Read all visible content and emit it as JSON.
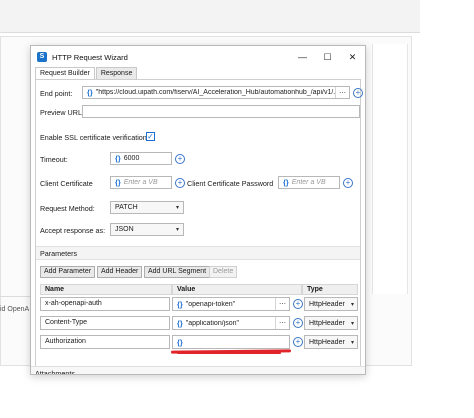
{
  "background": {
    "left_text": "id OpenA"
  },
  "dialog": {
    "title": "HTTP Request Wizard",
    "window_buttons": {
      "minimize": "—",
      "maximize": "☐",
      "close": "✕"
    },
    "tabs": [
      {
        "label": "Request Builder",
        "active": true
      },
      {
        "label": "Response",
        "active": false
      }
    ],
    "fields": {
      "end_point": {
        "label": "End point:",
        "value": "\"https://cloud.uipath.com/fiserv/AI_Acceleration_Hub/automationhub_/api/v1/..."
      },
      "preview_url": {
        "label": "Preview URL:",
        "value": ""
      },
      "ssl": {
        "label": "Enable SSL certificate verification",
        "checked": true
      },
      "timeout": {
        "label": "Timeout:",
        "value": "6000"
      },
      "client_certificate": {
        "label": "Client Certificate",
        "placeholder": "Enter a VB"
      },
      "client_certificate_password": {
        "label": "Client Certificate Password",
        "placeholder": "Enter a VB"
      },
      "request_method": {
        "label": "Request Method:",
        "value": "PATCH"
      },
      "accept_response": {
        "label": "Accept response as:",
        "value": "JSON"
      }
    },
    "parameters": {
      "header": "Parameters",
      "buttons": {
        "add_parameter": "Add Parameter",
        "add_header": "Add Header",
        "add_url_segment": "Add URL Segment",
        "delete": "Delete"
      },
      "columns": {
        "name": "Name",
        "value": "Value",
        "type": "Type"
      },
      "rows": [
        {
          "name": "x-ah-openapi-auth",
          "value": "\"openapi-token\"",
          "type": "HttpHeader"
        },
        {
          "name": "Content-Type",
          "value": "\"application/json\"",
          "type": "HttpHeader"
        },
        {
          "name": "Authorization",
          "value": "",
          "type": "HttpHeader"
        }
      ]
    },
    "attachments": {
      "header": "Attachments"
    },
    "icons": {
      "curly": "{}",
      "dots": "⋯",
      "plus": "+",
      "check": "✓",
      "caret": "▾"
    },
    "colors": {
      "accent": "#1a6fd1",
      "redaction": "#e0242a"
    }
  }
}
